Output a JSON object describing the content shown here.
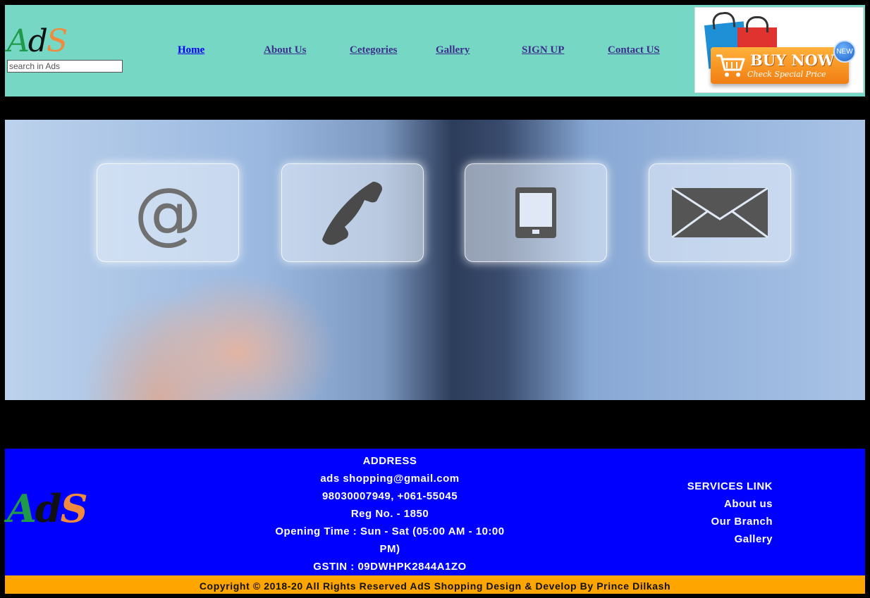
{
  "header": {
    "logo": {
      "a": "A",
      "d": "d",
      "s": "S"
    },
    "search_placeholder": "search in Ads",
    "nav": [
      "Home",
      "About Us",
      "Cetegories",
      "Gallery",
      "SIGN UP",
      "Contact US"
    ]
  },
  "ad": {
    "title": "BUY NOW",
    "subtitle": "Check Special Price",
    "badge": "NEW"
  },
  "banner": {
    "at_symbol": "@",
    "icons": [
      "email-icon",
      "phone-icon",
      "tablet-icon",
      "envelope-icon"
    ]
  },
  "footer": {
    "logo": {
      "a": "A",
      "d": "d",
      "s": "S"
    },
    "address": {
      "heading": "ADDRESS",
      "email": "ads shopping@gmail.com",
      "phones": "98030007949, +061-55045",
      "reg": "Reg No. - 1850",
      "opening": "Opening Time : Sun - Sat (05:00 AM - 10:00 PM)",
      "gstin": "GSTIN : 09DWHPK2844A1ZO"
    },
    "services": {
      "heading": "SERVICES LINK",
      "links": [
        "About us",
        "Our Branch",
        "Gallery"
      ]
    },
    "copyright": "Copyright © 2018-20 All Rights Reserved AdS Shopping Design & Develop By Prince Dilkash"
  },
  "colors": {
    "header_bg": "#76d7c4",
    "footer_bg": "#0000ff",
    "copyright_bg": "#ffa500",
    "logo_a": "#1f9a4a",
    "logo_s": "#f08a3c"
  }
}
